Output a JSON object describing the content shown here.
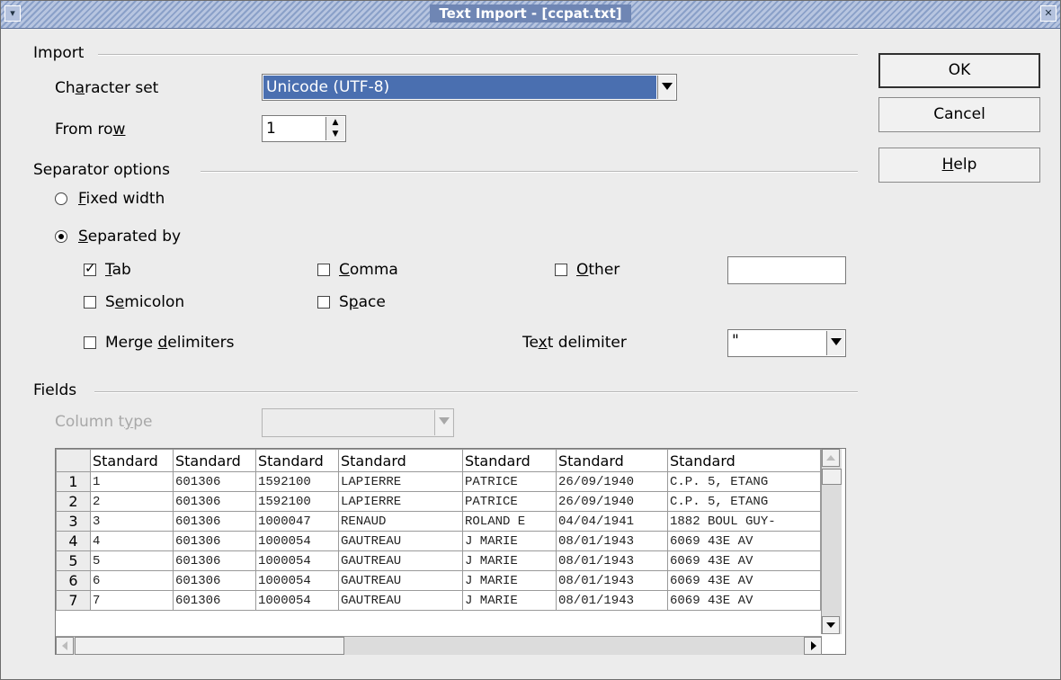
{
  "window": {
    "title": "Text Import - [ccpat.txt]",
    "menu_icon": "chevron-down-icon",
    "close_icon": "close-icon"
  },
  "import": {
    "legend": "Import",
    "charset_label_pre": "Ch",
    "charset_label_key": "a",
    "charset_label_post": "racter set",
    "charset_value": "Unicode (UTF-8)",
    "fromrow_label_pre": "From ro",
    "fromrow_label_key": "w",
    "fromrow_value": "1"
  },
  "separator": {
    "legend": "Separator options",
    "fixed_key": "F",
    "fixed_rest": "ixed width",
    "fixed_checked": false,
    "separated_key": "S",
    "separated_rest": "eparated by",
    "separated_checked": true,
    "tab_key": "T",
    "tab_rest": "ab",
    "tab_checked": true,
    "comma_key": "C",
    "comma_rest": "omma",
    "comma_checked": false,
    "other_key": "O",
    "other_rest": "ther",
    "other_checked": false,
    "other_value": "",
    "semicolon_pre": "S",
    "semicolon_key": "e",
    "semicolon_rest": "micolon",
    "semicolon_checked": false,
    "space_pre": "S",
    "space_key": "p",
    "space_rest": "ace",
    "space_checked": false,
    "merge_pre": "Merge ",
    "merge_key": "d",
    "merge_rest": "elimiters",
    "merge_checked": false,
    "textdelim_pre": "Te",
    "textdelim_key": "x",
    "textdelim_rest": "t delimiter",
    "textdelim_value": "\""
  },
  "fields": {
    "legend": "Fields",
    "coltype_pre": "Column t",
    "coltype_key": "y",
    "coltype_rest": "pe",
    "coltype_value": "",
    "headers": [
      "Standard",
      "Standard",
      "Standard",
      "Standard",
      "Standard",
      "Standard",
      "Standard"
    ],
    "rows": [
      [
        "1",
        "1",
        "601306",
        "1592100",
        "LAPIERRE",
        "PATRICE",
        "26/09/1940",
        "C.P. 5, ETANG"
      ],
      [
        "2",
        "2",
        "601306",
        "1592100",
        "LAPIERRE",
        "PATRICE",
        "26/09/1940",
        "C.P. 5, ETANG"
      ],
      [
        "3",
        "3",
        "601306",
        "1000047",
        "RENAUD",
        "ROLAND E",
        "04/04/1941",
        "1882 BOUL GUY-"
      ],
      [
        "4",
        "4",
        "601306",
        "1000054",
        "GAUTREAU",
        "J MARIE",
        "08/01/1943",
        "6069 43E AV"
      ],
      [
        "5",
        "5",
        "601306",
        "1000054",
        "GAUTREAU",
        "J MARIE",
        "08/01/1943",
        "6069 43E AV"
      ],
      [
        "6",
        "6",
        "601306",
        "1000054",
        "GAUTREAU",
        "J MARIE",
        "08/01/1943",
        "6069 43E AV"
      ],
      [
        "7",
        "7",
        "601306",
        "1000054",
        "GAUTREAU",
        "J MARIE",
        "08/01/1943",
        "6069 43E AV"
      ]
    ]
  },
  "buttons": {
    "ok": "OK",
    "cancel": "Cancel",
    "help_key": "H",
    "help_rest": "elp"
  },
  "colors": {
    "title_bar": "#8aa0c8",
    "dialog_bg": "#ececec",
    "selection": "#4a6fb0"
  }
}
